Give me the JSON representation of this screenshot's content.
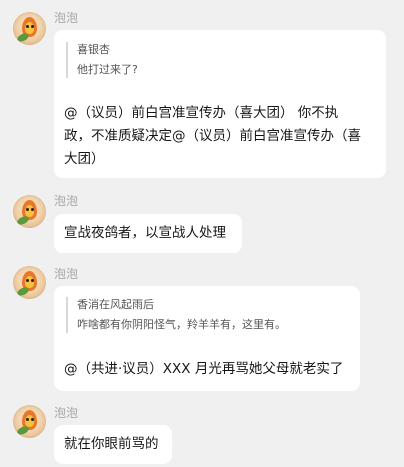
{
  "messages": [
    {
      "sender": "泡泡",
      "quote": {
        "name": "喜银杏",
        "text": "他打过来了?"
      },
      "lines": [
        "@（议员）前白宫准宣传办（喜大团） 你不执",
        "政，不准质疑决定@（议员）前白宫准宣传办（喜",
        "大团）"
      ]
    },
    {
      "sender": "泡泡",
      "lines": [
        "宣战夜鸽者，以宣战人处理"
      ]
    },
    {
      "sender": "泡泡",
      "quote": {
        "name": "香消在风起雨后",
        "text": "咋啥都有你阴阳怪气，羚羊羊有，这里有。"
      },
      "lines": [
        "@（共进·议员）XXX 月光再骂她父母就老实了"
      ]
    },
    {
      "sender": "泡泡",
      "lines": [
        "就在你眼前骂的"
      ]
    }
  ]
}
